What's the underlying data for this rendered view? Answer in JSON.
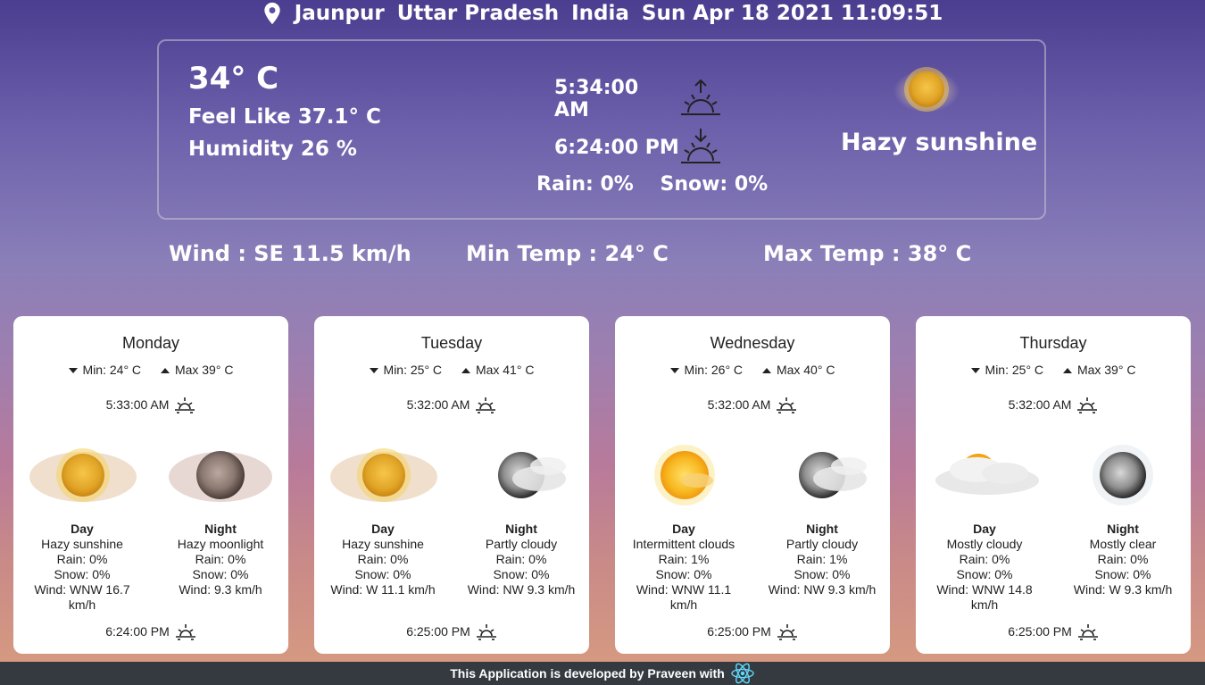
{
  "header": {
    "city": "Jaunpur",
    "state": "Uttar Pradesh",
    "country": "India",
    "datetime": "Sun Apr 18 2021 11:09:51"
  },
  "current": {
    "temperature": "34° C",
    "feels_like": "Feel Like 37.1° C",
    "humidity": "Humidity 26 %",
    "sunrise": "5:34:00 AM",
    "sunset": "6:24:00 PM",
    "rain": "Rain: 0%",
    "snow": "Snow: 0%",
    "condition": "Hazy sunshine",
    "icon": "hazy-sun-icon"
  },
  "stats": {
    "wind": "Wind :   SE 11.5 km/h",
    "min_temp": "Min Temp : 24° C",
    "max_temp": "Max Temp : 38° C"
  },
  "forecast": [
    {
      "day": "Monday",
      "min": "Min: 24° C",
      "max": "Max 39° C",
      "sunrise": "5:33:00 AM",
      "sunset": "6:24:00 PM",
      "day_label": "Day",
      "day_condition": "Hazy sunshine",
      "day_rain": "Rain: 0%",
      "day_snow": "Snow: 0%",
      "day_wind": "Wind: WNW 16.7 km/h",
      "night_label": "Night",
      "night_condition": "Hazy moonlight",
      "night_rain": "Rain: 0%",
      "night_snow": "Snow: 0%",
      "night_wind": "Wind: 9.3 km/h"
    },
    {
      "day": "Tuesday",
      "min": "Min: 25° C",
      "max": "Max 41° C",
      "sunrise": "5:32:00 AM",
      "sunset": "6:25:00 PM",
      "day_label": "Day",
      "day_condition": "Hazy sunshine",
      "day_rain": "Rain: 0%",
      "day_snow": "Snow: 0%",
      "day_wind": "Wind: W 11.1 km/h",
      "night_label": "Night",
      "night_condition": "Partly cloudy",
      "night_rain": "Rain: 0%",
      "night_snow": "Snow: 0%",
      "night_wind": "Wind: NW 9.3 km/h"
    },
    {
      "day": "Wednesday",
      "min": "Min: 26° C",
      "max": "Max 40° C",
      "sunrise": "5:32:00 AM",
      "sunset": "6:25:00 PM",
      "day_label": "Day",
      "day_condition": "Intermittent clouds",
      "day_rain": "Rain: 1%",
      "day_snow": "Snow: 0%",
      "day_wind": "Wind: WNW 11.1 km/h",
      "night_label": "Night",
      "night_condition": "Partly cloudy",
      "night_rain": "Rain: 1%",
      "night_snow": "Snow: 0%",
      "night_wind": "Wind: NW 9.3 km/h"
    },
    {
      "day": "Thursday",
      "min": "Min: 25° C",
      "max": "Max 39° C",
      "sunrise": "5:32:00 AM",
      "sunset": "6:25:00 PM",
      "day_label": "Day",
      "day_condition": "Mostly cloudy",
      "day_rain": "Rain: 0%",
      "day_snow": "Snow: 0%",
      "day_wind": "Wind: WNW 14.8 km/h",
      "night_label": "Night",
      "night_condition": "Mostly clear",
      "night_rain": "Rain: 0%",
      "night_snow": "Snow: 0%",
      "night_wind": "Wind: W 9.3 km/h"
    }
  ],
  "footer": {
    "text": "This Application is developed by Praveen with",
    "icon": "react-logo-icon"
  }
}
